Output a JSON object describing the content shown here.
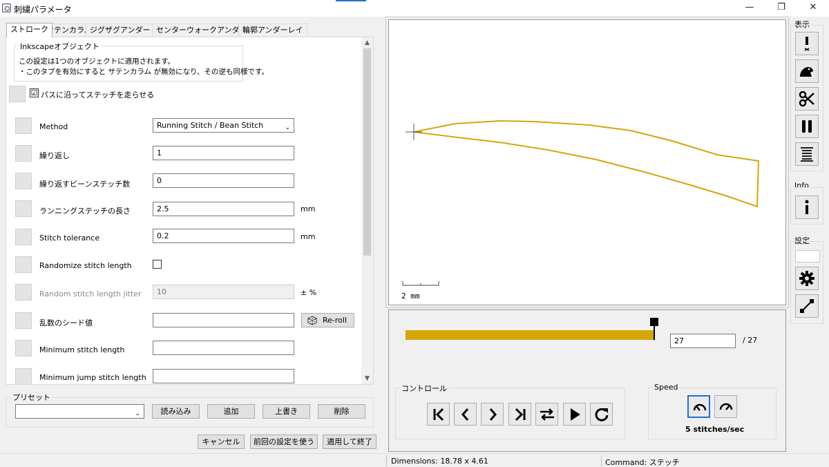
{
  "window": {
    "title": "刺繍パラメータ",
    "minimize": "—",
    "restore": "❐",
    "close": "✕"
  },
  "tabs": [
    {
      "label": "ストローク"
    },
    {
      "label": "サテンカラム"
    },
    {
      "label": "ジグザグアンダーレイ"
    },
    {
      "label": "センターウォークアンダーレイ"
    },
    {
      "label": "輪郭アンダーレイ"
    }
  ],
  "info_group": {
    "title": "Inkscapeオブジェクト",
    "line1": "この設定は1つのオブジェクトに適用されます。",
    "line2": "・このタブを有効にすると サテンカラム が無効になり、その逆も同様です。"
  },
  "enable": {
    "checked": "☑",
    "label": "パスに沿ってステッチを走らせる"
  },
  "params": {
    "method": {
      "label": "Method",
      "value": "Running Stitch / Bean Stitch"
    },
    "repeats": {
      "label": "繰り返し",
      "value": "1"
    },
    "bean_repeats": {
      "label": "繰り返すビーンステッチ数",
      "value": "0"
    },
    "running_length": {
      "label": "ランニングステッチの長さ",
      "value": "2.5",
      "unit": "mm"
    },
    "tolerance": {
      "label": "Stitch tolerance",
      "value": "0.2",
      "unit": "mm"
    },
    "randomize": {
      "label": "Randomize stitch length"
    },
    "jitter": {
      "label": "Random stitch length jitter",
      "value": "10",
      "unit": "± %"
    },
    "seed": {
      "label": "乱数のシード値",
      "value": "",
      "reroll": "Re-roll"
    },
    "min_stitch": {
      "label": "Minimum stitch length",
      "value": ""
    },
    "min_jump": {
      "label": "Minimum jump stitch length",
      "value": ""
    }
  },
  "preset": {
    "title": "プリセット",
    "value": "",
    "load": "読み込み",
    "add": "追加",
    "overwrite": "上書き",
    "delete": "削除"
  },
  "actions": {
    "cancel": "キャンセル",
    "use_last": "前回の設定を使う",
    "apply_quit": "適用して終了"
  },
  "preview": {
    "scale_label": "2 mm",
    "stroke_color": "#d4a60a",
    "progress_fraction": 1.0,
    "current_stitch": "27",
    "total_stitches": "/ 27"
  },
  "controls": {
    "title": "コントロール"
  },
  "speed": {
    "title": "Speed",
    "value": "5 stitches/sec"
  },
  "right_toolbar": {
    "show_title": "表示",
    "info_title": "Info",
    "settings_title": "設定"
  },
  "status": {
    "dimensions": "Dimensions: 18.78 x 4.61",
    "command": "Command: ステッチ"
  }
}
